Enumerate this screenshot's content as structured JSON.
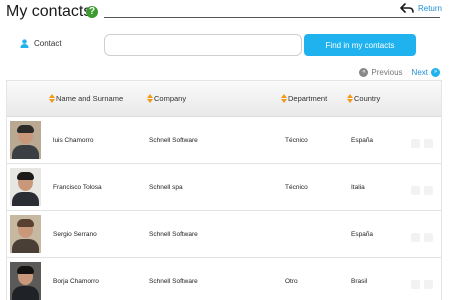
{
  "header": {
    "title": "My contacts",
    "help_icon": "?",
    "return_label": "Return"
  },
  "search": {
    "label": "Contact",
    "value": "",
    "placeholder": "",
    "button_label": "Find in my contacts"
  },
  "pager": {
    "previous_label": "Previous",
    "next_label": "Next"
  },
  "table": {
    "columns": [
      "Name and Surname",
      "Company",
      "Department",
      "Country"
    ],
    "rows": [
      {
        "name": "luis Chamorro",
        "company": "Schnell Software",
        "department": "Técnico",
        "country": "España"
      },
      {
        "name": "Francisco Tolosa",
        "company": "Schnell spa",
        "department": "Técnico",
        "country": "Italia"
      },
      {
        "name": "Sergio Serrano",
        "company": "Schnell Software",
        "department": "",
        "country": "España"
      },
      {
        "name": "Borja Chamorro",
        "company": "Schnell Software",
        "department": "Otro",
        "country": "Brasil"
      }
    ]
  },
  "colors": {
    "accent": "#1fb2ef",
    "link": "#1f8ed6",
    "help_green": "#3c9b2e",
    "sort_orange": "#f29a1b"
  }
}
